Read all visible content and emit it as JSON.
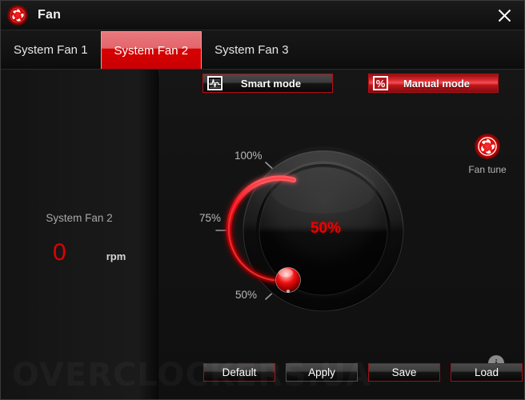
{
  "window": {
    "title": "Fan",
    "logo_icon": "fan-aperture-logo",
    "close_icon": "close-icon"
  },
  "tabs": [
    {
      "label": "System Fan 1",
      "active": false
    },
    {
      "label": "System Fan 2",
      "active": true
    },
    {
      "label": "System Fan 3",
      "active": false
    }
  ],
  "left_panel": {
    "fan_name": "System Fan 2",
    "rpm_value": "0",
    "rpm_unit": "rpm"
  },
  "modes": {
    "smart": {
      "label": "Smart mode",
      "icon": "waveform-chart-icon",
      "active": false
    },
    "manual": {
      "label": "Manual mode",
      "icon": "percent-icon",
      "active": true
    }
  },
  "fan_tune": {
    "label": "Fan tune",
    "icon": "fan-aperture-icon"
  },
  "knob": {
    "value_label": "50%",
    "value": 50,
    "ticks": [
      {
        "label": "100%",
        "value": 100
      },
      {
        "label": "75%",
        "value": 75
      },
      {
        "label": "50%",
        "value": 50
      }
    ]
  },
  "info": {
    "icon": "info-icon",
    "glyph": "i"
  },
  "buttons": [
    {
      "label": "Default",
      "style": "red"
    },
    {
      "label": "Apply",
      "style": "neutral"
    },
    {
      "label": "Save",
      "style": "red"
    },
    {
      "label": "Load",
      "style": "red"
    }
  ],
  "watermark": "OVERCLOCKERS.UA",
  "colors": {
    "accent_red": "#d80000",
    "bright_red": "#ee0000",
    "tab_active_top": "#e7787c",
    "panel_bg": "#121212",
    "text_primary": "#e6e6e6",
    "text_muted": "#a8a8a8"
  }
}
